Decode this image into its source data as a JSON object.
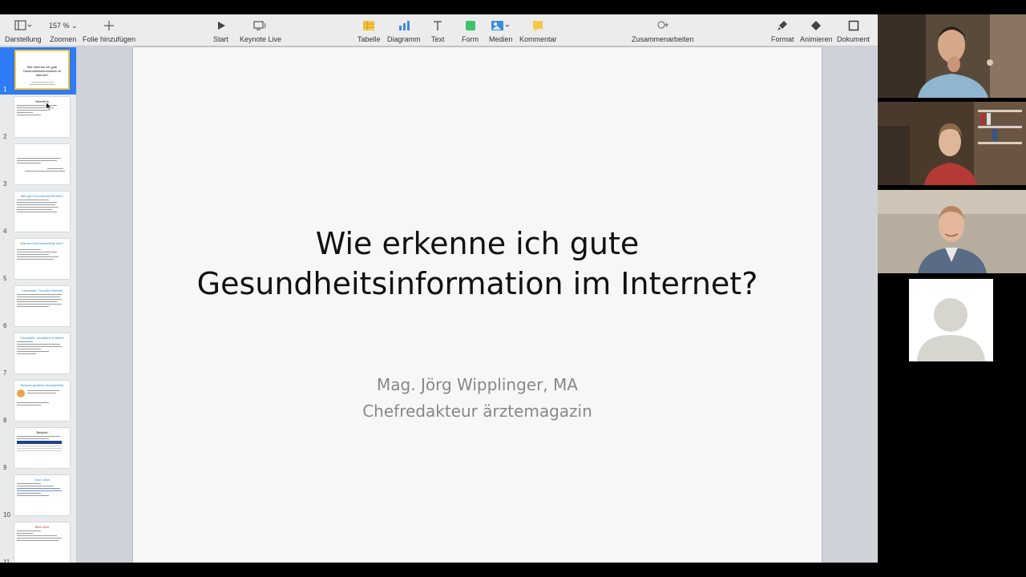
{
  "toolbar": {
    "darstellung": "Darstellung",
    "zoom_value": "157 %",
    "zoomen": "Zoomen",
    "folie_hinzufuegen": "Folie hinzufügen",
    "start": "Start",
    "keynote_live": "Keynote Live",
    "tabelle": "Tabelle",
    "diagramm": "Diagramm",
    "text": "Text",
    "form": "Form",
    "medien": "Medien",
    "kommentar": "Kommentar",
    "zusammenarbeiten": "Zusammenarbeiten",
    "format": "Format",
    "animieren": "Animieren",
    "dokument": "Dokument"
  },
  "sidebar": {
    "slides": [
      {
        "number": "1",
        "title": ""
      },
      {
        "number": "2",
        "title": "Überblick"
      },
      {
        "number": "3",
        "title": ""
      },
      {
        "number": "4",
        "title": "Wie gut Gesundheits-Medien?"
      },
      {
        "number": "5",
        "title": "Warum nicht entdeckbar sein?"
      },
      {
        "number": "6",
        "title": "Checkliste: Formale Kriterien"
      },
      {
        "number": "7",
        "title": "Checkliste: Inhaltliche Kriterien"
      },
      {
        "number": "8",
        "title": "Beispiel (positive Anzeigelinie)"
      },
      {
        "number": "9",
        "title": "Beispiel"
      },
      {
        "number": "10",
        "title": "Gute Links"
      },
      {
        "number": "11",
        "title": "Bitte nicht"
      }
    ]
  },
  "slide": {
    "title_line1": "Wie erkenne ich gute",
    "title_line2": "Gesundheitsinformation im Internet?",
    "subtitle_line1": "Mag. Jörg Wipplinger, MA",
    "subtitle_line2": "Chefredakteur ärztemagazin"
  },
  "colors": {
    "accent": "#2f7cf6",
    "selection_border": "#f4c644",
    "title": "#111111",
    "subtitle": "#888888"
  }
}
